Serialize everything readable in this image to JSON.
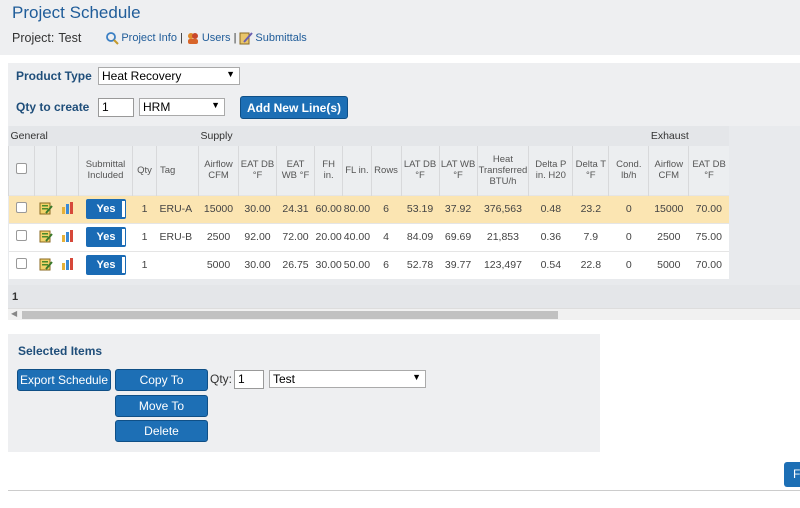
{
  "header": {
    "title": "Project Schedule",
    "project_label": "Project:",
    "project_name": "Test",
    "links": [
      "Project Info",
      "Users",
      "Submittals"
    ]
  },
  "controls": {
    "product_type_label": "Product Type",
    "product_type_value": "Heat Recovery",
    "qty_label": "Qty to create",
    "qty_value": "1",
    "model_value": "HRM",
    "add_button": "Add New Line(s)"
  },
  "table": {
    "groups": [
      "General",
      "Supply",
      "Exhaust"
    ],
    "headers": [
      "",
      "",
      "",
      "Submittal Included",
      "Qty",
      "Tag",
      "Airflow CFM",
      "EAT DB °F",
      "EAT WB °F",
      "FH in.",
      "FL in.",
      "Rows",
      "LAT DB °F",
      "LAT WB °F",
      "Heat Transferred BTU/h",
      "Delta P in. H20",
      "Delta T °F",
      "Cond. lb/h",
      "Airflow CFM",
      "EAT DB °F"
    ],
    "rows": [
      {
        "submittal": "Yes",
        "qty": "1",
        "tag": "ERU-A",
        "airflow": "15000",
        "eat_db": "30.00",
        "eat_wb": "24.31",
        "fh": "60.00",
        "fl": "80.00",
        "rows": "6",
        "lat_db": "53.19",
        "lat_wb": "37.92",
        "heat": "376,563",
        "dp": "0.48",
        "dt": "23.2",
        "cond": "0",
        "ex_airflow": "15000",
        "ex_eat_db": "70.00"
      },
      {
        "submittal": "Yes",
        "qty": "1",
        "tag": "ERU-B",
        "airflow": "2500",
        "eat_db": "92.00",
        "eat_wb": "72.00",
        "fh": "20.00",
        "fl": "40.00",
        "rows": "4",
        "lat_db": "84.09",
        "lat_wb": "69.69",
        "heat": "21,853",
        "dp": "0.36",
        "dt": "7.9",
        "cond": "0",
        "ex_airflow": "2500",
        "ex_eat_db": "75.00"
      },
      {
        "submittal": "Yes",
        "qty": "1",
        "tag": "",
        "airflow": "5000",
        "eat_db": "30.00",
        "eat_wb": "26.75",
        "fh": "30.00",
        "fl": "50.00",
        "rows": "6",
        "lat_db": "52.78",
        "lat_wb": "39.77",
        "heat": "123,497",
        "dp": "0.54",
        "dt": "22.8",
        "cond": "0",
        "ex_airflow": "5000",
        "ex_eat_db": "70.00"
      }
    ],
    "page": "1"
  },
  "selected": {
    "title": "Selected Items",
    "export_button": "Export Schedule",
    "copy_button": "Copy To",
    "qty_label": "Qty:",
    "qty_value": "1",
    "target_value": "Test",
    "move_button": "Move To",
    "delete_button": "Delete"
  },
  "right_button": "F",
  "colors": {
    "accent": "#1d6fb5",
    "title": "#1f5c99",
    "highlight_row": "#fbe5b2",
    "panel_bg": "#eeeff1"
  }
}
